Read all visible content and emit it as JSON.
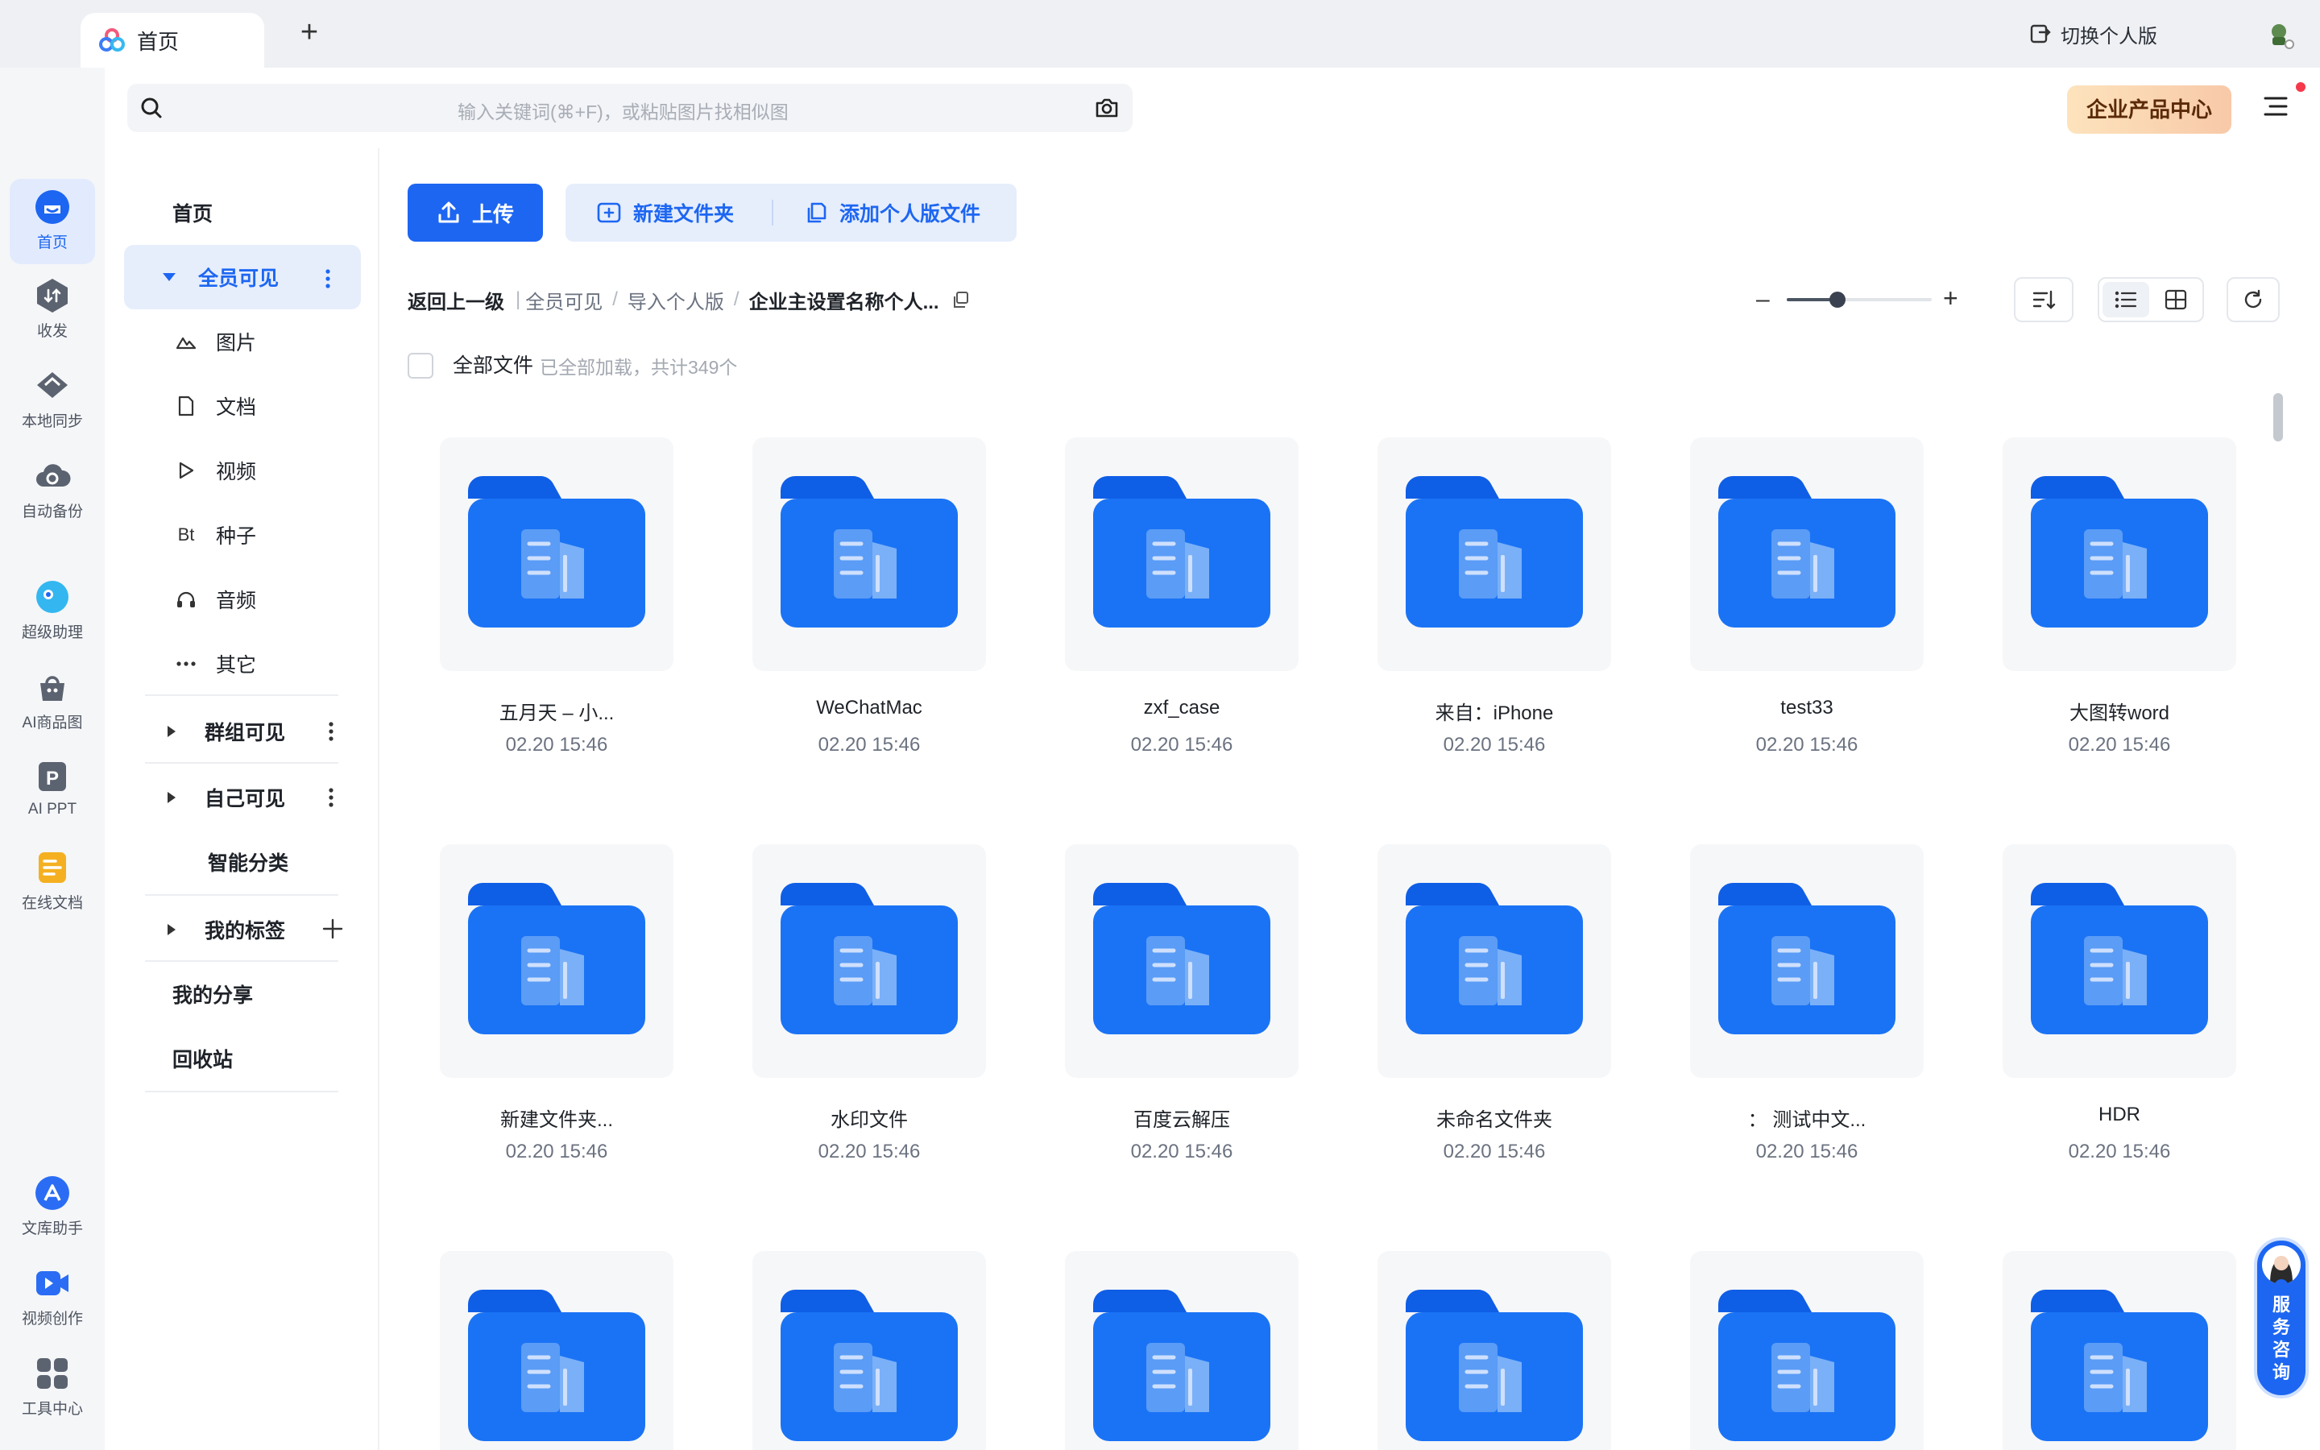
{
  "tabs": [
    {
      "label": "首页"
    }
  ],
  "top_right": {
    "switch_label": "切换个人版"
  },
  "search": {
    "placeholder": "输入关键词(⌘+F)，或粘贴图片找相似图"
  },
  "enterprise_button": "企业产品中心",
  "rail": [
    {
      "label": "首页",
      "icon": "home-icon",
      "active": true
    },
    {
      "label": "收发",
      "icon": "transfer-icon"
    },
    {
      "label": "本地同步",
      "icon": "sync-icon"
    },
    {
      "label": "自动备份",
      "icon": "backup-icon"
    },
    {
      "label": "超级助理",
      "icon": "assistant-icon"
    },
    {
      "label": "AI商品图",
      "icon": "ai-product-icon"
    },
    {
      "label": "AI PPT",
      "icon": "ai-ppt-icon"
    },
    {
      "label": "在线文档",
      "icon": "online-doc-icon"
    },
    {
      "label": "文库助手",
      "icon": "library-icon"
    },
    {
      "label": "视频创作",
      "icon": "video-create-icon"
    },
    {
      "label": "工具中心",
      "icon": "tools-icon"
    }
  ],
  "nav": {
    "home": "首页",
    "all_visible": "全员可见",
    "sub": [
      {
        "label": "图片",
        "icon": "image-icon"
      },
      {
        "label": "文档",
        "icon": "document-icon"
      },
      {
        "label": "视频",
        "icon": "video-icon"
      },
      {
        "label": "种子",
        "icon": "torrent-icon",
        "glyph": "Bt"
      },
      {
        "label": "音频",
        "icon": "audio-icon"
      },
      {
        "label": "其它",
        "icon": "more-icon"
      }
    ],
    "group_visible": "群组可见",
    "self_visible": "自己可见",
    "smart": "智能分类",
    "tags": "我的标签",
    "share": "我的分享",
    "trash": "回收站"
  },
  "toolbar": {
    "upload": "上传",
    "new_folder": "新建文件夹",
    "add_personal": "添加个人版文件"
  },
  "breadcrumb": {
    "back": "返回上一级",
    "items": [
      "全员可见",
      "导入个人版"
    ],
    "current": "企业主设置名称个人..."
  },
  "zoom": {
    "level": 0.35
  },
  "selection": {
    "label": "全部文件",
    "note": "已全部加载，共计349个"
  },
  "files": [
    {
      "name": "五月天 – 小...",
      "date": "02.20 15:46"
    },
    {
      "name": "WeChatMac",
      "date": "02.20 15:46"
    },
    {
      "name": "zxf_case",
      "date": "02.20 15:46"
    },
    {
      "name": "来自：iPhone",
      "date": "02.20 15:46"
    },
    {
      "name": "test33",
      "date": "02.20 15:46"
    },
    {
      "name": "大图转word",
      "date": "02.20 15:46"
    },
    {
      "name": "新建文件夹...",
      "date": "02.20 15:46"
    },
    {
      "name": "水印文件",
      "date": "02.20 15:46"
    },
    {
      "name": "百度云解压",
      "date": "02.20 15:46"
    },
    {
      "name": "未命名文件夹",
      "date": "02.20 15:46"
    },
    {
      "name": "：  测试中文...",
      "date": "02.20 15:46"
    },
    {
      "name": "HDR",
      "date": "02.20 15:46"
    },
    {
      "name": "",
      "date": ""
    },
    {
      "name": "",
      "date": ""
    },
    {
      "name": "",
      "date": ""
    },
    {
      "name": "",
      "date": ""
    },
    {
      "name": "",
      "date": ""
    },
    {
      "name": "",
      "date": ""
    }
  ],
  "service": {
    "label": "服务咨询"
  },
  "colors": {
    "accent": "#1d66f2",
    "folder": "#1a73f5",
    "folder_tab": "#0f5ee6"
  }
}
